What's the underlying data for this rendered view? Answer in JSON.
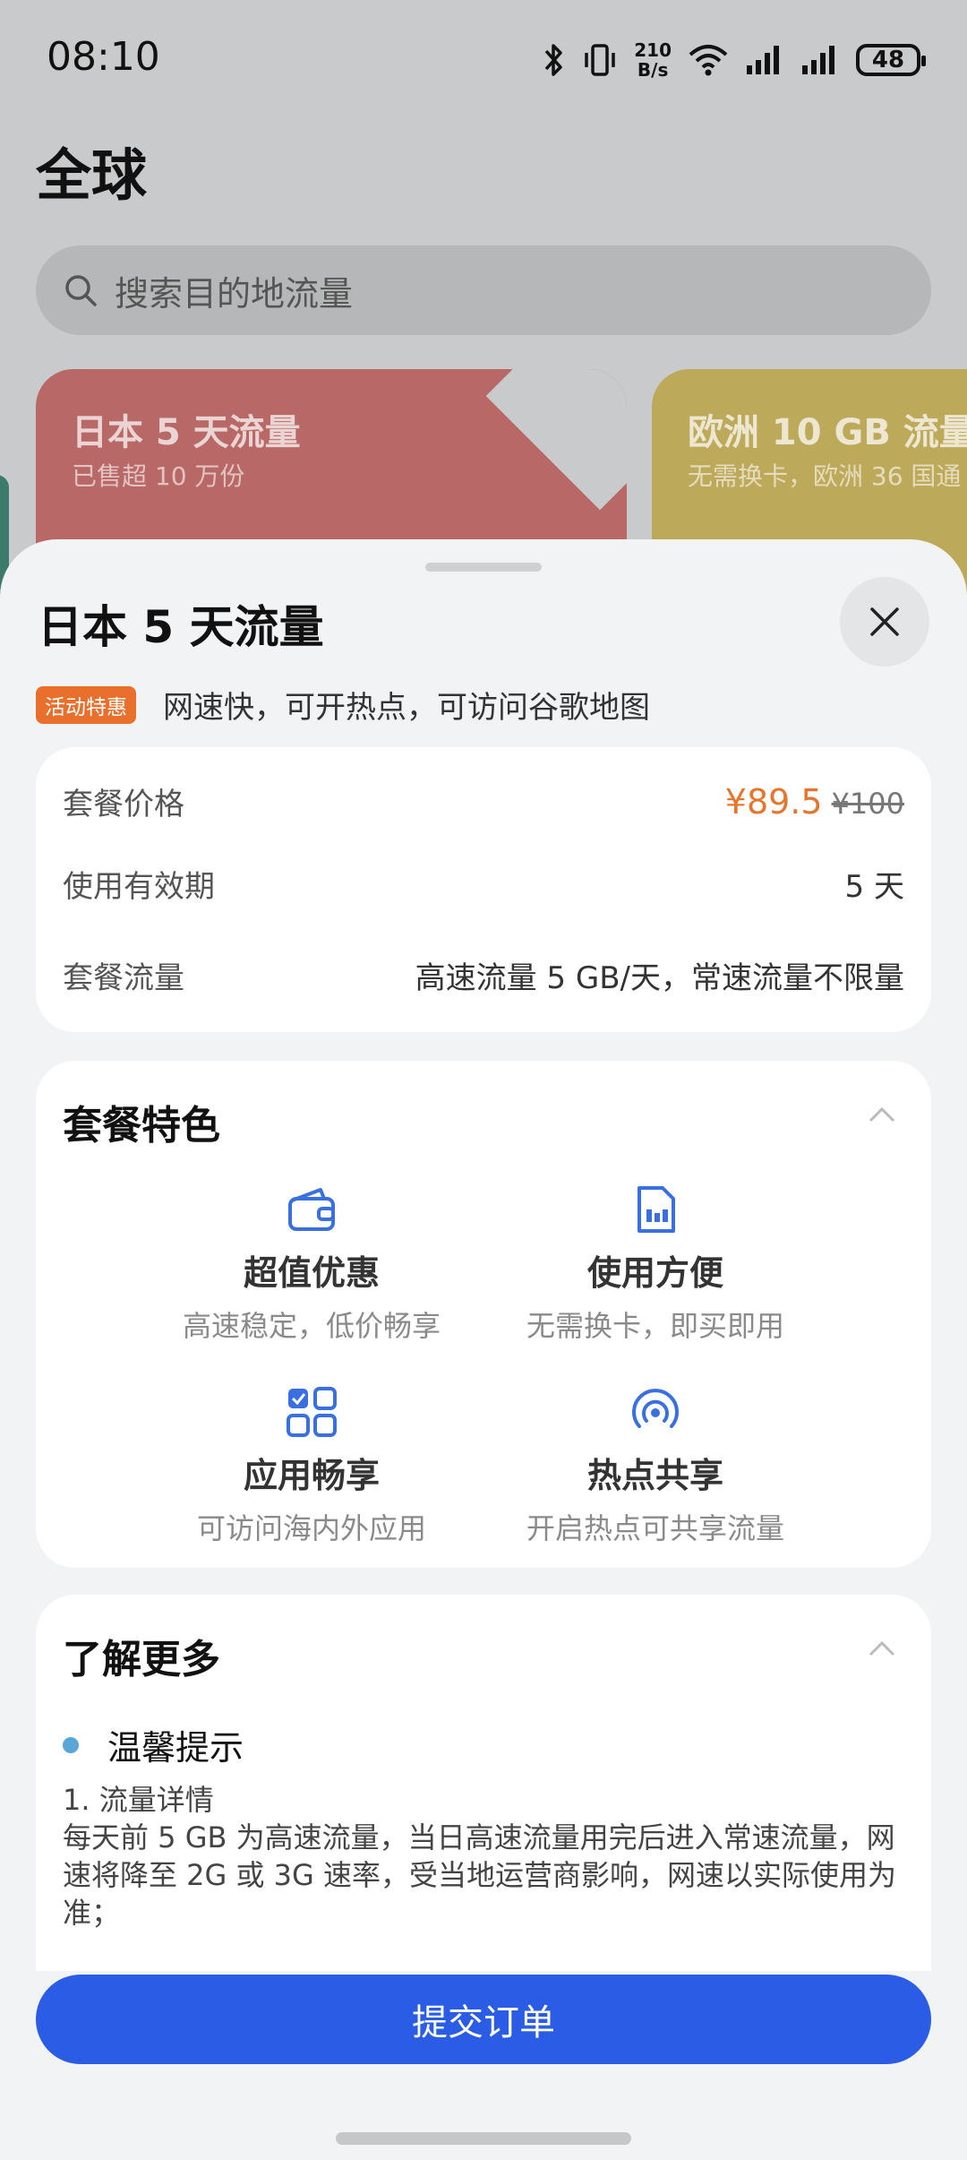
{
  "status_bar": {
    "time": "08:10",
    "net_speed_top": "210",
    "net_speed_bottom": "B/s",
    "battery": "48",
    "icons": [
      "bluetooth-icon",
      "vibrate-icon",
      "wifi-icon",
      "signal-icon",
      "signal-icon"
    ]
  },
  "page": {
    "title": "全球",
    "search_placeholder": "搜索目的地流量",
    "cards": [
      {
        "title": "日本 5 天流量",
        "subtitle": "已售超 10 万份",
        "color": "#b86866"
      },
      {
        "title": "欧洲 10 GB 流量",
        "subtitle": "无需换卡，欧洲 36 国通",
        "color": "#bda95a"
      }
    ]
  },
  "sheet": {
    "title": "日本 5 天流量",
    "promo_badge": "活动特惠",
    "promo_text": "网速快，可开热点，可访问谷歌地图",
    "price_label": "套餐价格",
    "price_now": "¥89.5",
    "price_old": "¥100",
    "validity_label": "使用有效期",
    "validity_value": "5 天",
    "data_label": "套餐流量",
    "data_value": "高速流量 5 GB/天，常速流量不限量",
    "features_title": "套餐特色",
    "features": [
      {
        "title": "超值优惠",
        "desc": "高速稳定，低价畅享",
        "icon": "wallet-icon"
      },
      {
        "title": "使用方便",
        "desc": "无需换卡，即买即用",
        "icon": "sim-card-icon"
      },
      {
        "title": "应用畅享",
        "desc": "可访问海内外应用",
        "icon": "apps-grid-icon"
      },
      {
        "title": "热点共享",
        "desc": "开启热点可共享流量",
        "icon": "hotspot-icon"
      }
    ],
    "more_title": "了解更多",
    "tip_title": "温馨提示",
    "tip_heading": "1. 流量详情",
    "tip_body": "每天前 5 GB 为高速流量，当日高速流量用完后进入常速流量，网速将降至 2G 或 3G 速率，受当地运营商影响，网速以实际使用为准；",
    "submit_label": "提交订单"
  },
  "colors": {
    "accent": "#2a5ce6",
    "price": "#e5762e",
    "promo_badge": "#e96f2d",
    "icon_blue": "#3a6fe0"
  }
}
